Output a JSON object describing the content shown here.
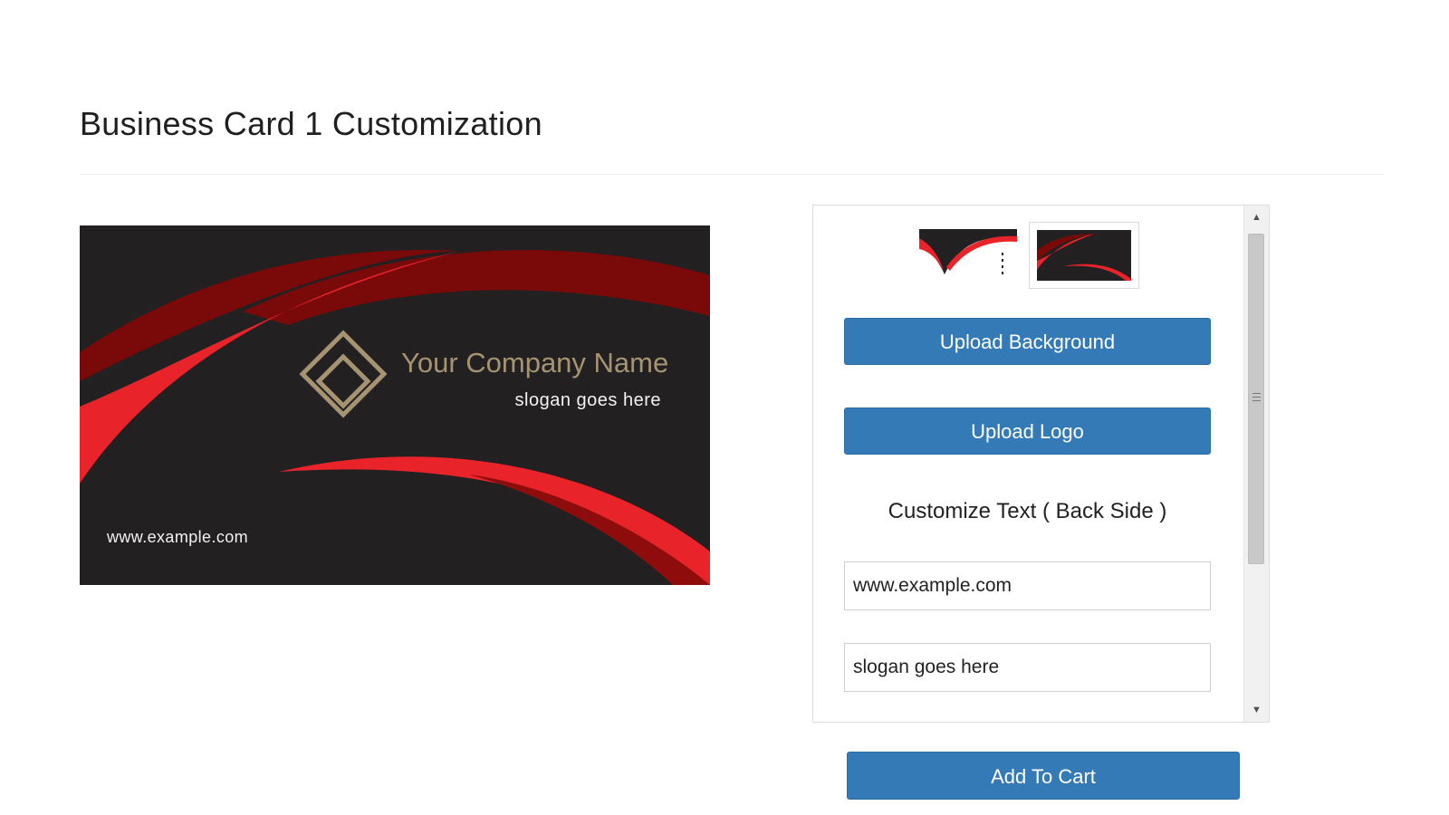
{
  "page": {
    "title": "Business Card 1 Customization"
  },
  "card_preview": {
    "company_name": "Your Company Name",
    "slogan": "slogan goes here",
    "website": "www.example.com",
    "background_color": "#222021",
    "accent_red": "#e8232a",
    "accent_dark_red": "#7a0a0a",
    "company_text_color": "#a69372"
  },
  "panel": {
    "thumbnails": [
      {
        "label": "card-front-thumbnail"
      },
      {
        "label": "card-back-thumbnail",
        "selected": true
      }
    ],
    "upload_background_label": "Upload Background",
    "upload_logo_label": "Upload Logo",
    "section_label": "Customize Text ( Back Side )",
    "website_field_value": "www.example.com",
    "slogan_field_value": "slogan goes here",
    "scroll_up_icon": "▲",
    "scroll_down_icon": "▼"
  },
  "actions": {
    "add_to_cart_label": "Add To Cart",
    "button_color": "#337ab7"
  }
}
